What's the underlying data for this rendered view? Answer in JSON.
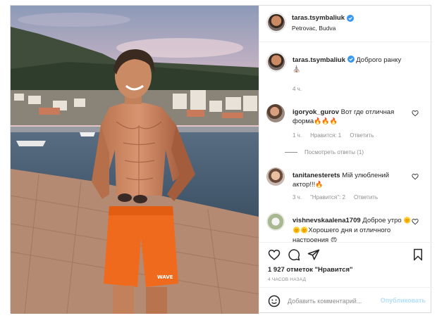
{
  "post": {
    "author": {
      "username": "taras.tsymbaliuk",
      "location": "Petrovac, Budva",
      "verified": true
    },
    "caption": {
      "username": "taras.tsymbaliuk",
      "text": "Доброго ранку",
      "emoji": "⛪",
      "time": "4 ч."
    },
    "comments": [
      {
        "username": "igoryok_gurov",
        "text": "Вот где отличная форма",
        "emoji": "🔥🔥🔥",
        "time": "1 ч.",
        "likes": "Нравится: 1",
        "reply": "Ответить",
        "view_replies": "Посмотреть ответы (1)"
      },
      {
        "username": "tanitanesterets",
        "text": "Мій улюблений актор!!!",
        "emoji": "🔥",
        "time": "3 ч.",
        "likes": "\"Нравится\": 2",
        "reply": "Ответить"
      },
      {
        "username": "vishnevskaalena1709",
        "text_before": "Доброе утро",
        "sun_emoji": "🌞🌞🌞",
        "text_after": "Хорошего дня и отличного настроения",
        "end_emoji": "😍"
      }
    ],
    "likes_count": "1 927 отметок \"Нравится\"",
    "time_ago": "4 ЧАСОВ НАЗАД",
    "add_comment": {
      "placeholder": "Добавить комментарий...",
      "publish": "Опубликовать"
    }
  },
  "icons": {
    "like": "heart-icon",
    "comment": "comment-icon",
    "share": "paper-plane-icon",
    "save": "bookmark-icon",
    "emoji": "smiley-icon",
    "verified": "verified-badge-icon"
  },
  "colors": {
    "verified": "#3897f0",
    "muted": "#8e8e8e",
    "publish_disabled": "#b2dffc",
    "border": "#dbdbdb"
  }
}
